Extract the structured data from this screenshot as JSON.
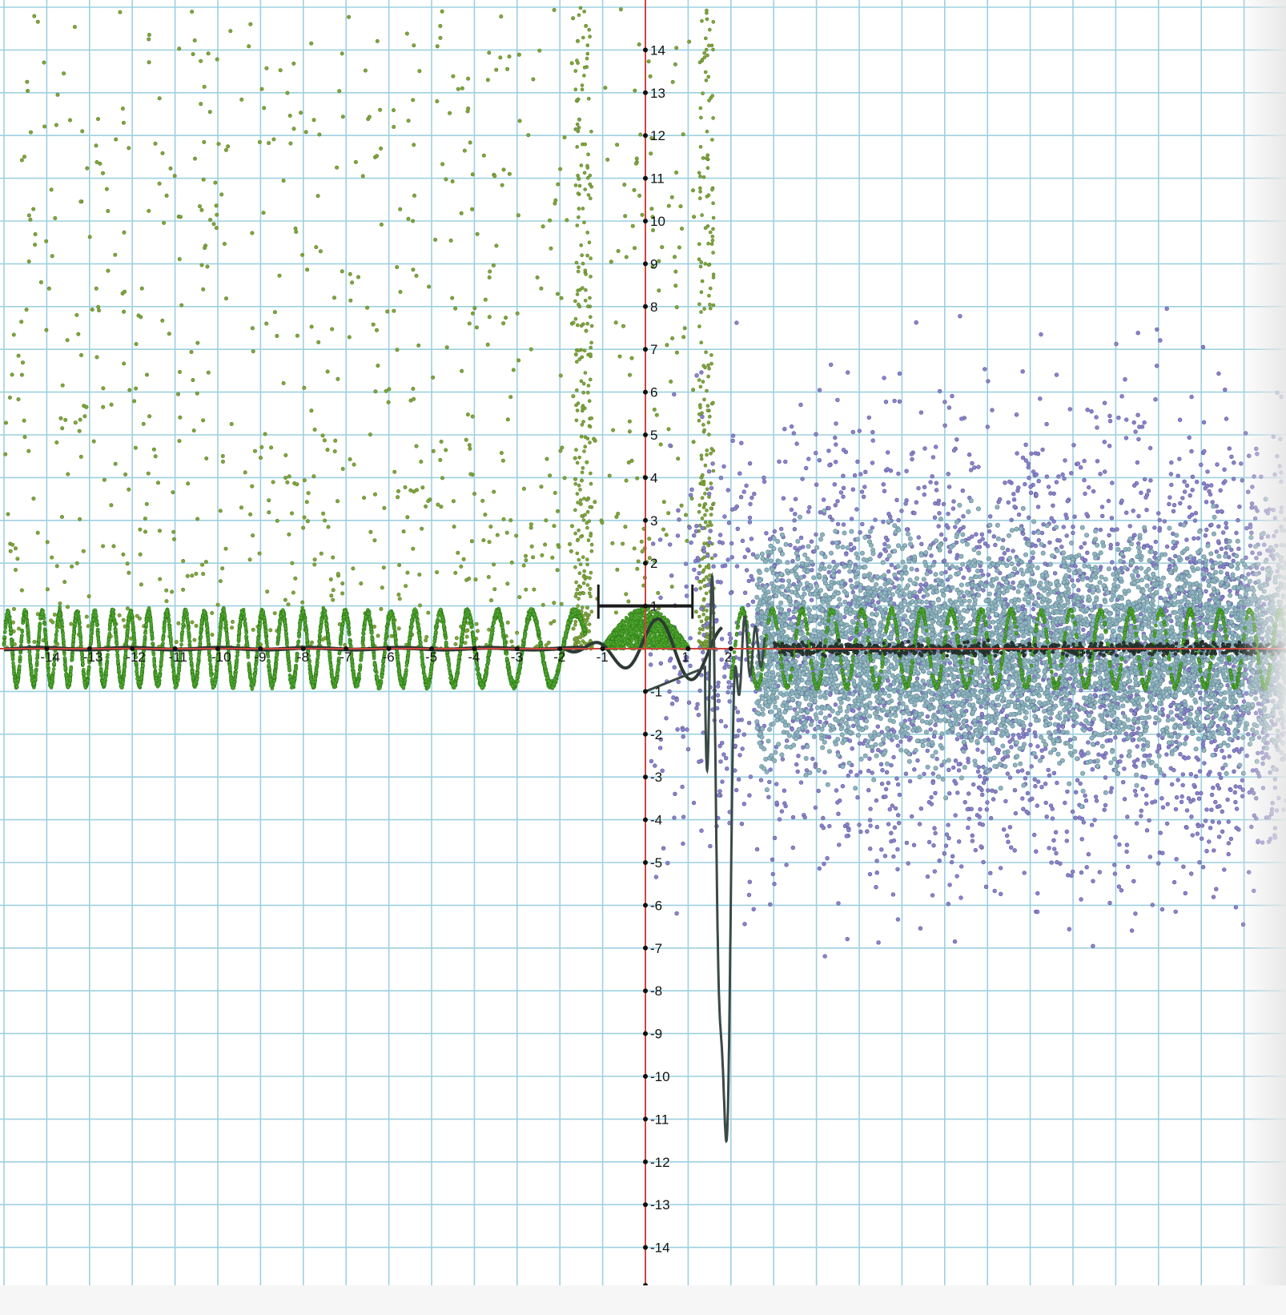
{
  "chart_data": {
    "type": "scatter",
    "title": "",
    "xlabel": "",
    "ylabel": "",
    "xlim": [
      -15.1,
      14.9
    ],
    "ylim": [
      -15,
      15
    ],
    "grid": true,
    "x_tick_labels": [
      "-14",
      "-13",
      "-12",
      "-11",
      "-10",
      "-9",
      "-8",
      "-7",
      "-6",
      "-5",
      "-4",
      "-3",
      "-2",
      "-1",
      "1",
      "2"
    ],
    "y_tick_labels": [
      "14",
      "13",
      "12",
      "11",
      "10",
      "9",
      "8",
      "7",
      "6",
      "5",
      "4",
      "3",
      "2",
      "1",
      "-1",
      "-2",
      "-3",
      "-4",
      "-5",
      "-6",
      "-7",
      "-8",
      "-9",
      "-10",
      "-11",
      "-12",
      "-13",
      "-14"
    ],
    "series": [
      {
        "description_free": true,
        "color": "#7ea63c",
        "region_x": [
          -15,
          1.5
        ],
        "region_y": [
          -1,
          15
        ]
      },
      {
        "color": "#4fa82e",
        "region_x": [
          -15,
          15
        ],
        "region_y": [
          -1,
          1
        ]
      },
      {
        "color": "#8a84c8",
        "region_x": [
          0,
          15
        ],
        "region_y": [
          -15,
          15
        ]
      },
      {
        "color": "#8fb4c0",
        "region_x": [
          2,
          15
        ],
        "region_y": [
          -6,
          5
        ]
      },
      {
        "color": "#2d3a34",
        "region_x": [
          -15,
          15
        ],
        "region_y": [
          -1.2,
          1
        ]
      }
    ]
  },
  "colors": {
    "grid": "#9ed0e0",
    "axis": "#d0443a",
    "green": "#7ea63c",
    "bright_green": "#4fa82e",
    "purple": "#8a84c8",
    "blue_gray": "#8fb4c0",
    "curve": "#2d3a34"
  }
}
